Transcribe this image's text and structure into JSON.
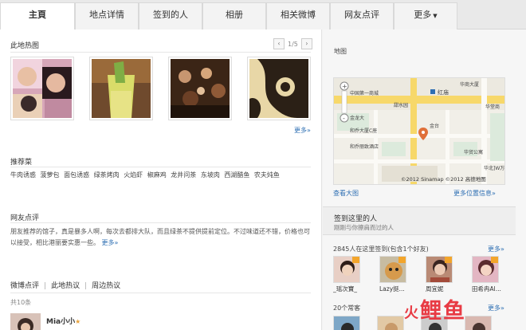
{
  "tabs": [
    {
      "label": "主頁",
      "active": true
    },
    {
      "label": "地点详情"
    },
    {
      "label": "签到的人"
    },
    {
      "label": "相册"
    },
    {
      "label": "相关微博"
    },
    {
      "label": "网友点评"
    },
    {
      "label": "更多"
    }
  ],
  "photos_section": {
    "title": "此地热图",
    "pager": {
      "current": "1/5",
      "prev": "‹",
      "next": "›"
    },
    "more": "更多»"
  },
  "dishes": {
    "title": "推荐菜",
    "items": [
      "牛肉诱惑",
      "菠萝包",
      "面包诱惑",
      "绿茶烤肉",
      "火焰虾",
      "椒麻鸡",
      "龙井问茶",
      "东坡肉",
      "西湖醋鱼",
      "农夫炖鱼"
    ]
  },
  "reviews": {
    "title": "网友点评",
    "text": "朋友推荐的馆子，真是暴多人啊，每次去都排大队，而且绿茶不提供提前定位。不过味道还不错，价格也可以接受，相比港丽要实惠一些。",
    "more": "更多»"
  },
  "weibo": {
    "tabs": [
      "微博点评",
      "此地热议",
      "周边热议"
    ],
    "count": "共10条",
    "first_user": "Mia小小"
  },
  "map": {
    "title": "地图",
    "labels": [
      "华商大厦",
      "中国第一商城",
      "红庙",
      "华堂商",
      "甜水园",
      "和乔大厦C座",
      "金台",
      "金龙大",
      "和乔丽致酒店",
      "华贸公寓",
      "华北]W万",
      "©2012 Sinamap ©2012 高德地图"
    ],
    "view_large": "查看大图",
    "more_locations": "更多位置信息»"
  },
  "checkins": {
    "title": "签到这里的人",
    "subtitle": "刚刚与你擦肩而过的人",
    "count": "2845人在这里签到(包含1个好友)",
    "more": "更多»",
    "people": [
      "_瑶次寶_",
      "Lazy挺...",
      "周宜妮",
      "田希冉Al..."
    ],
    "regulars_count": "20个常客",
    "regulars_more": "更多»"
  },
  "watermark": {
    "text": "鲤鱼",
    "brand": "火"
  }
}
